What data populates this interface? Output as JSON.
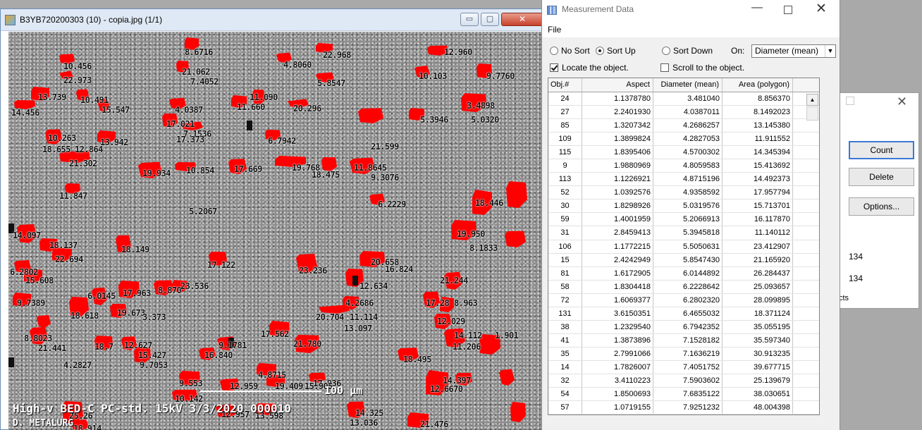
{
  "viewer": {
    "title": "B3YB720200303 (10) - copia.jpg (1/1)",
    "minimize_label": "▭",
    "maximize_label": "▢",
    "close_label": "✕",
    "sem_info": "High-v BED-C PC-std. 15kV 3/3/2020 000010",
    "sem_org": "D. METALURG",
    "scale_label": "100 μm",
    "accent_color": "#ff0000",
    "labels": [
      "8.6716",
      "10.456",
      "22.973",
      "21.062",
      "7.4052",
      "4.8060",
      "22.968",
      "12.960",
      "10.103",
      "9.7760",
      "5.8547",
      "13.739",
      "10.491",
      "15.547",
      "14.456",
      "4.0387",
      "11.660",
      "11.090",
      "20.296",
      "3.4898",
      "5.0320",
      "5.3946",
      "17.021",
      "7.1536",
      "17.373",
      "6.7942",
      "21.599",
      "10.263",
      "18.655",
      "12.864",
      "13.942",
      "21.302",
      "19.934",
      "10.854",
      "17.669",
      "19.768",
      "18.475",
      "11.8645",
      "9.3076",
      "11.847",
      "5.2067",
      "6.2229",
      "18.446",
      "14.097",
      "18.137",
      "18.149",
      "22.694",
      "17.122",
      "6.2802",
      "15.608",
      "23.236",
      "20.658",
      "16.824",
      "12.634",
      "21.244",
      "19.950",
      "8.1833",
      "9.7389",
      "6.0145",
      "17.963",
      "8.870",
      "23.536",
      "18.618",
      "19.673",
      "3.373",
      "4.2686",
      "20.704",
      "11.114",
      "13.097",
      "17.28",
      "8.963",
      "12.029",
      "8.8023",
      "21.441",
      "18.7",
      "12.627",
      "17.562",
      "21.780",
      "9.1781",
      "4.2827",
      "15.427",
      "9.7053",
      "16.840",
      "4.8715",
      "17.936",
      "15.905",
      "11.206",
      "14.112",
      "1.901",
      "18.495",
      "12.6670",
      "14.397",
      "9.553",
      "12.959",
      "19.409",
      "10.142",
      "25.26",
      "12.957",
      "13.598",
      "14.325",
      "13.036",
      "21.476",
      "18.914"
    ]
  },
  "back_dialog": {
    "count_label": "Count",
    "delete_label": "Delete",
    "options_label": "Options...",
    "value_1": "134",
    "value_2": "134",
    "fragment": "cts"
  },
  "measure": {
    "title": "Measurement Data",
    "menu_file": "File",
    "sort_options": [
      "No Sort",
      "Sort Up",
      "Sort Down"
    ],
    "sort_selected": 1,
    "on_label": "On:",
    "sort_key": "Diameter (mean)",
    "locate_label": "Locate the object.",
    "locate_checked": true,
    "scroll_label": "Scroll to the object.",
    "scroll_checked": false,
    "columns": [
      "Obj.#",
      "Aspect",
      "Diameter (mean)",
      "Area (polygon)"
    ],
    "rows": [
      [
        "24",
        "1.1378780",
        "3.481040",
        "8.856370"
      ],
      [
        "27",
        "2.2401930",
        "4.0387011",
        "8.1492023"
      ],
      [
        "85",
        "1.3207342",
        "4.2686257",
        "13.145380"
      ],
      [
        "109",
        "1.3899824",
        "4.2827053",
        "11.911552"
      ],
      [
        "115",
        "1.8395406",
        "4.5700302",
        "14.345394"
      ],
      [
        "9",
        "1.9880969",
        "4.8059583",
        "15.413692"
      ],
      [
        "113",
        "1.1226921",
        "4.8715196",
        "14.492373"
      ],
      [
        "52",
        "1.0392576",
        "4.9358592",
        "17.957794"
      ],
      [
        "30",
        "1.8298926",
        "5.0319576",
        "15.713701"
      ],
      [
        "59",
        "1.4001959",
        "5.2066913",
        "16.117870"
      ],
      [
        "31",
        "2.8459413",
        "5.3945818",
        "11.140112"
      ],
      [
        "106",
        "1.1772215",
        "5.5050631",
        "23.412907"
      ],
      [
        "15",
        "2.4242949",
        "5.8547430",
        "21.165920"
      ],
      [
        "81",
        "1.6172905",
        "6.0144892",
        "26.284437"
      ],
      [
        "58",
        "1.8304418",
        "6.2228642",
        "25.093657"
      ],
      [
        "72",
        "1.6069377",
        "6.2802320",
        "28.099895"
      ],
      [
        "131",
        "3.6150351",
        "6.4655032",
        "18.371124"
      ],
      [
        "38",
        "1.2329540",
        "6.7942352",
        "35.055195"
      ],
      [
        "41",
        "1.3873896",
        "7.1528182",
        "35.597340"
      ],
      [
        "35",
        "2.7991066",
        "7.1636219",
        "30.913235"
      ],
      [
        "14",
        "1.7826007",
        "7.4051752",
        "39.677715"
      ],
      [
        "32",
        "3.4110223",
        "7.5903602",
        "25.139679"
      ],
      [
        "54",
        "1.8500693",
        "7.6835122",
        "38.030651"
      ],
      [
        "57",
        "1.0719155",
        "7.9251232",
        "48.004398"
      ]
    ]
  }
}
